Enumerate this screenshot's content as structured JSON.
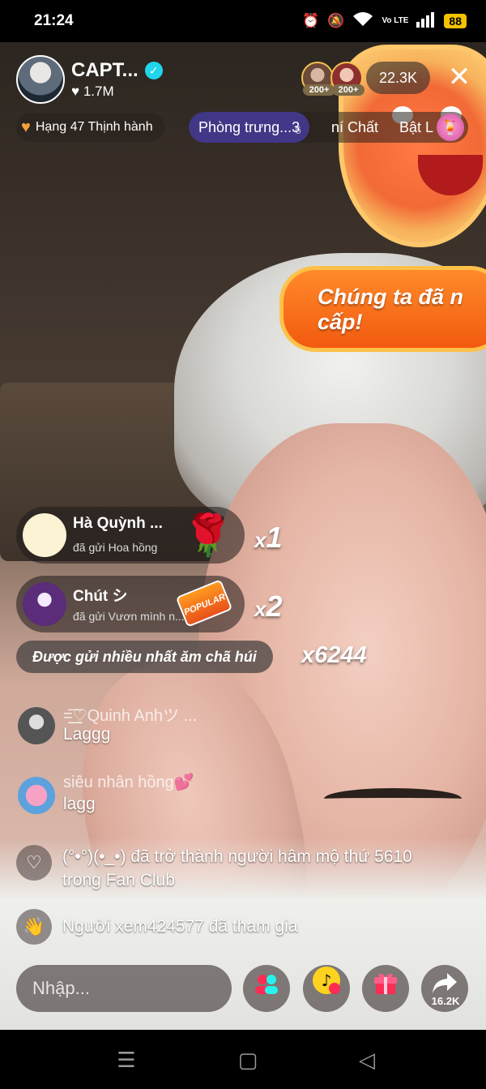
{
  "status_bar": {
    "time": "21:24",
    "network": "Vo LTE",
    "battery": "88"
  },
  "streamer": {
    "name": "CAPT...",
    "likes": "1.7M"
  },
  "viewers": {
    "badge1": "200+",
    "badge2": "200+",
    "count": "22.3K"
  },
  "rank": {
    "label": "Hạng 47 Thịnh hành"
  },
  "features": {
    "room": "Phòng trưng...",
    "room_count": "3",
    "room_sub": "6",
    "chat": "ní Chất",
    "bat": "Bật L"
  },
  "sticker_banner": {
    "line1": "Chúng ta đã n",
    "line2": "cấp!"
  },
  "gifts": [
    {
      "name": "Hà Quỳnh ...",
      "desc": "đã gửi Hoa hồng",
      "count_prefix": "x",
      "count": "1",
      "icon": "rose-icon"
    },
    {
      "name": "Chút シ",
      "desc": "đã gửi Vươn mình n...",
      "count_prefix": "x",
      "count": "2",
      "icon": "popular-icon",
      "icon_text": "POPULAR"
    }
  ],
  "most_sent": {
    "label": "Được gửi nhiều nhất ăm chã húi",
    "count": "x6244"
  },
  "chat": [
    {
      "user": "=͟͟͞♡Quinh Anhツ ...",
      "text": "Laggg"
    },
    {
      "user": "siêu nhân hồng💕",
      "text": "lagg"
    }
  ],
  "system_messages": [
    {
      "line1": "(°•°)(•_•) đã trở thành người hâm mộ thứ 5610",
      "line2": "trong Fan Club",
      "icon": "heart-outline-icon"
    },
    {
      "line1": "Người xem424577 đã tham gia",
      "icon": "wave-hand-icon"
    }
  ],
  "input": {
    "placeholder": "Nhập..."
  },
  "share": {
    "count": "16.2K"
  },
  "colors": {
    "accent": "#20d5ec",
    "gift_pink": "#fe2c55",
    "banner_orange": "#f25a0f"
  }
}
